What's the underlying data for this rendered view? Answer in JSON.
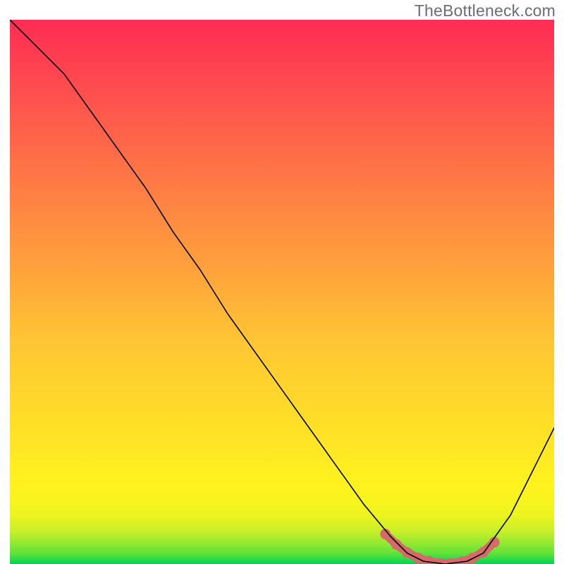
{
  "watermark": "TheBottleneck.com",
  "chart_data": {
    "type": "line",
    "title": "",
    "xlabel": "",
    "ylabel": "",
    "xlim": [
      0,
      100
    ],
    "ylim": [
      0,
      100
    ],
    "background_gradient": {
      "stops": [
        {
          "y": 0,
          "color": "#00d455"
        },
        {
          "y": 2,
          "color": "#64e23a"
        },
        {
          "y": 6,
          "color": "#c9ef28"
        },
        {
          "y": 9,
          "color": "#edf41f"
        },
        {
          "y": 14,
          "color": "#fff31e"
        },
        {
          "y": 40,
          "color": "#ffc733"
        },
        {
          "y": 70,
          "color": "#ff7a45"
        },
        {
          "y": 100,
          "color": "#ff2c55"
        }
      ]
    },
    "series": [
      {
        "name": "curve-black",
        "color": "#000000",
        "width": 1.6,
        "points": [
          {
            "x": 0,
            "y": 100
          },
          {
            "x": 5,
            "y": 95
          },
          {
            "x": 10,
            "y": 90
          },
          {
            "x": 15,
            "y": 83
          },
          {
            "x": 20,
            "y": 76
          },
          {
            "x": 25,
            "y": 69
          },
          {
            "x": 30,
            "y": 61
          },
          {
            "x": 35,
            "y": 54
          },
          {
            "x": 40,
            "y": 46
          },
          {
            "x": 45,
            "y": 39
          },
          {
            "x": 50,
            "y": 32
          },
          {
            "x": 55,
            "y": 25
          },
          {
            "x": 60,
            "y": 18
          },
          {
            "x": 65,
            "y": 11
          },
          {
            "x": 70,
            "y": 5
          },
          {
            "x": 73,
            "y": 2
          },
          {
            "x": 76,
            "y": 0.5
          },
          {
            "x": 80,
            "y": 0
          },
          {
            "x": 84,
            "y": 0.5
          },
          {
            "x": 87,
            "y": 2
          },
          {
            "x": 92,
            "y": 9
          },
          {
            "x": 96,
            "y": 17
          },
          {
            "x": 100,
            "y": 25
          }
        ]
      },
      {
        "name": "minimum-marker",
        "color": "#d46a6a",
        "width": 7.5,
        "points": [
          {
            "x": 69,
            "y": 5.5
          },
          {
            "x": 71,
            "y": 3.6
          },
          {
            "x": 73,
            "y": 2.1
          },
          {
            "x": 75,
            "y": 1.1
          },
          {
            "x": 77,
            "y": 0.5
          },
          {
            "x": 79,
            "y": 0.1
          },
          {
            "x": 81,
            "y": 0.1
          },
          {
            "x": 83,
            "y": 0.4
          },
          {
            "x": 85,
            "y": 1.1
          },
          {
            "x": 87,
            "y": 2.2
          },
          {
            "x": 89,
            "y": 4.0
          }
        ]
      }
    ]
  }
}
